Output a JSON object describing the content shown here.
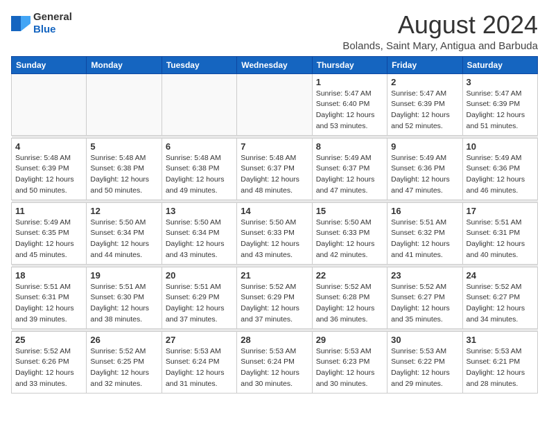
{
  "logo": {
    "general": "General",
    "blue": "Blue"
  },
  "title": {
    "month_year": "August 2024",
    "location": "Bolands, Saint Mary, Antigua and Barbuda"
  },
  "days_of_week": [
    "Sunday",
    "Monday",
    "Tuesday",
    "Wednesday",
    "Thursday",
    "Friday",
    "Saturday"
  ],
  "weeks": [
    [
      {
        "day": "",
        "info": ""
      },
      {
        "day": "",
        "info": ""
      },
      {
        "day": "",
        "info": ""
      },
      {
        "day": "",
        "info": ""
      },
      {
        "day": "1",
        "info": "Sunrise: 5:47 AM\nSunset: 6:40 PM\nDaylight: 12 hours\nand 53 minutes."
      },
      {
        "day": "2",
        "info": "Sunrise: 5:47 AM\nSunset: 6:39 PM\nDaylight: 12 hours\nand 52 minutes."
      },
      {
        "day": "3",
        "info": "Sunrise: 5:47 AM\nSunset: 6:39 PM\nDaylight: 12 hours\nand 51 minutes."
      }
    ],
    [
      {
        "day": "4",
        "info": "Sunrise: 5:48 AM\nSunset: 6:39 PM\nDaylight: 12 hours\nand 50 minutes."
      },
      {
        "day": "5",
        "info": "Sunrise: 5:48 AM\nSunset: 6:38 PM\nDaylight: 12 hours\nand 50 minutes."
      },
      {
        "day": "6",
        "info": "Sunrise: 5:48 AM\nSunset: 6:38 PM\nDaylight: 12 hours\nand 49 minutes."
      },
      {
        "day": "7",
        "info": "Sunrise: 5:48 AM\nSunset: 6:37 PM\nDaylight: 12 hours\nand 48 minutes."
      },
      {
        "day": "8",
        "info": "Sunrise: 5:49 AM\nSunset: 6:37 PM\nDaylight: 12 hours\nand 47 minutes."
      },
      {
        "day": "9",
        "info": "Sunrise: 5:49 AM\nSunset: 6:36 PM\nDaylight: 12 hours\nand 47 minutes."
      },
      {
        "day": "10",
        "info": "Sunrise: 5:49 AM\nSunset: 6:36 PM\nDaylight: 12 hours\nand 46 minutes."
      }
    ],
    [
      {
        "day": "11",
        "info": "Sunrise: 5:49 AM\nSunset: 6:35 PM\nDaylight: 12 hours\nand 45 minutes."
      },
      {
        "day": "12",
        "info": "Sunrise: 5:50 AM\nSunset: 6:34 PM\nDaylight: 12 hours\nand 44 minutes."
      },
      {
        "day": "13",
        "info": "Sunrise: 5:50 AM\nSunset: 6:34 PM\nDaylight: 12 hours\nand 43 minutes."
      },
      {
        "day": "14",
        "info": "Sunrise: 5:50 AM\nSunset: 6:33 PM\nDaylight: 12 hours\nand 43 minutes."
      },
      {
        "day": "15",
        "info": "Sunrise: 5:50 AM\nSunset: 6:33 PM\nDaylight: 12 hours\nand 42 minutes."
      },
      {
        "day": "16",
        "info": "Sunrise: 5:51 AM\nSunset: 6:32 PM\nDaylight: 12 hours\nand 41 minutes."
      },
      {
        "day": "17",
        "info": "Sunrise: 5:51 AM\nSunset: 6:31 PM\nDaylight: 12 hours\nand 40 minutes."
      }
    ],
    [
      {
        "day": "18",
        "info": "Sunrise: 5:51 AM\nSunset: 6:31 PM\nDaylight: 12 hours\nand 39 minutes."
      },
      {
        "day": "19",
        "info": "Sunrise: 5:51 AM\nSunset: 6:30 PM\nDaylight: 12 hours\nand 38 minutes."
      },
      {
        "day": "20",
        "info": "Sunrise: 5:51 AM\nSunset: 6:29 PM\nDaylight: 12 hours\nand 37 minutes."
      },
      {
        "day": "21",
        "info": "Sunrise: 5:52 AM\nSunset: 6:29 PM\nDaylight: 12 hours\nand 37 minutes."
      },
      {
        "day": "22",
        "info": "Sunrise: 5:52 AM\nSunset: 6:28 PM\nDaylight: 12 hours\nand 36 minutes."
      },
      {
        "day": "23",
        "info": "Sunrise: 5:52 AM\nSunset: 6:27 PM\nDaylight: 12 hours\nand 35 minutes."
      },
      {
        "day": "24",
        "info": "Sunrise: 5:52 AM\nSunset: 6:27 PM\nDaylight: 12 hours\nand 34 minutes."
      }
    ],
    [
      {
        "day": "25",
        "info": "Sunrise: 5:52 AM\nSunset: 6:26 PM\nDaylight: 12 hours\nand 33 minutes."
      },
      {
        "day": "26",
        "info": "Sunrise: 5:52 AM\nSunset: 6:25 PM\nDaylight: 12 hours\nand 32 minutes."
      },
      {
        "day": "27",
        "info": "Sunrise: 5:53 AM\nSunset: 6:24 PM\nDaylight: 12 hours\nand 31 minutes."
      },
      {
        "day": "28",
        "info": "Sunrise: 5:53 AM\nSunset: 6:24 PM\nDaylight: 12 hours\nand 30 minutes."
      },
      {
        "day": "29",
        "info": "Sunrise: 5:53 AM\nSunset: 6:23 PM\nDaylight: 12 hours\nand 30 minutes."
      },
      {
        "day": "30",
        "info": "Sunrise: 5:53 AM\nSunset: 6:22 PM\nDaylight: 12 hours\nand 29 minutes."
      },
      {
        "day": "31",
        "info": "Sunrise: 5:53 AM\nSunset: 6:21 PM\nDaylight: 12 hours\nand 28 minutes."
      }
    ]
  ]
}
